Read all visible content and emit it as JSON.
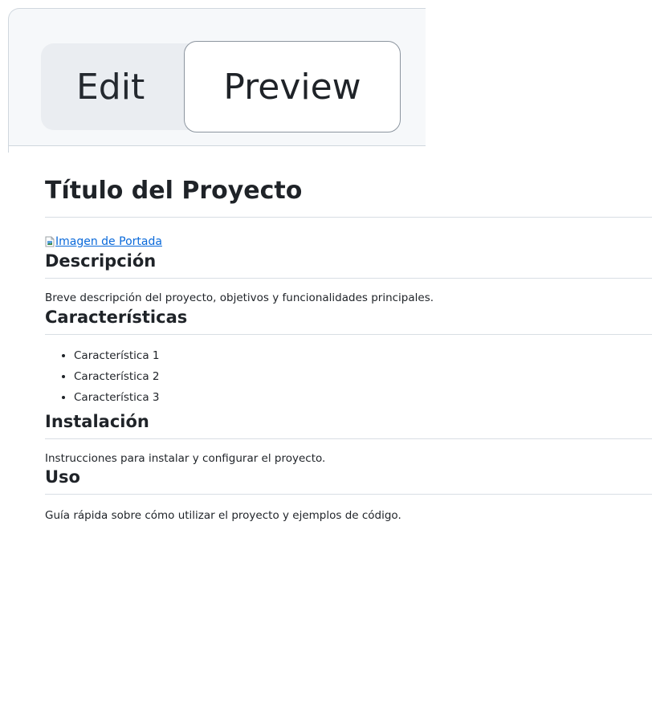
{
  "tabs": {
    "edit_label": "Edit",
    "preview_label": "Preview",
    "active": "Preview"
  },
  "document": {
    "title": "Título del Proyecto",
    "cover_image_alt": "Imagen de Portada",
    "sections": {
      "description": {
        "heading": "Descripción",
        "body": "Breve descripción del proyecto, objetivos y funcionalidades principales."
      },
      "features": {
        "heading": "Características",
        "items": [
          "Característica 1",
          "Característica 2",
          "Característica 3"
        ]
      },
      "installation": {
        "heading": "Instalación",
        "body": "Instrucciones para instalar y configurar el proyecto."
      },
      "usage": {
        "heading": "Uso",
        "body": "Guía rápida sobre cómo utilizar el proyecto y ejemplos de código."
      }
    }
  },
  "colors": {
    "link": "#0969da",
    "text": "#1f2328",
    "divider": "#d8dee4",
    "tabbar_bg": "#f6f8fa"
  },
  "icons": {
    "cover_image": "broken-image-icon"
  }
}
